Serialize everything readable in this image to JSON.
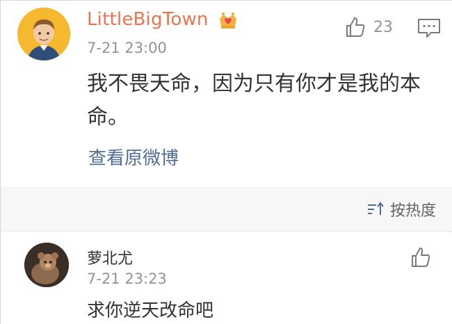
{
  "main_comment": {
    "username": "LittleBigTown",
    "timestamp": "7-21 23:00",
    "like_count": "23",
    "content": "我不畏天命，因为只有你才是我的本命。",
    "view_original": "查看原微博"
  },
  "sort": {
    "label": "按热度"
  },
  "reply": {
    "username": "萝北尤",
    "timestamp": "7-21 23:23",
    "content": "求你逆天改命吧"
  },
  "colors": {
    "username_accent": "#eb7350",
    "link": "#506c97",
    "muted": "#939393",
    "avatar_bg": "#f5b82e"
  },
  "icons": {
    "crown": "crown-heart-icon",
    "like": "thumbs-up-icon",
    "comment": "comment-icon",
    "sort": "sort-icon"
  }
}
